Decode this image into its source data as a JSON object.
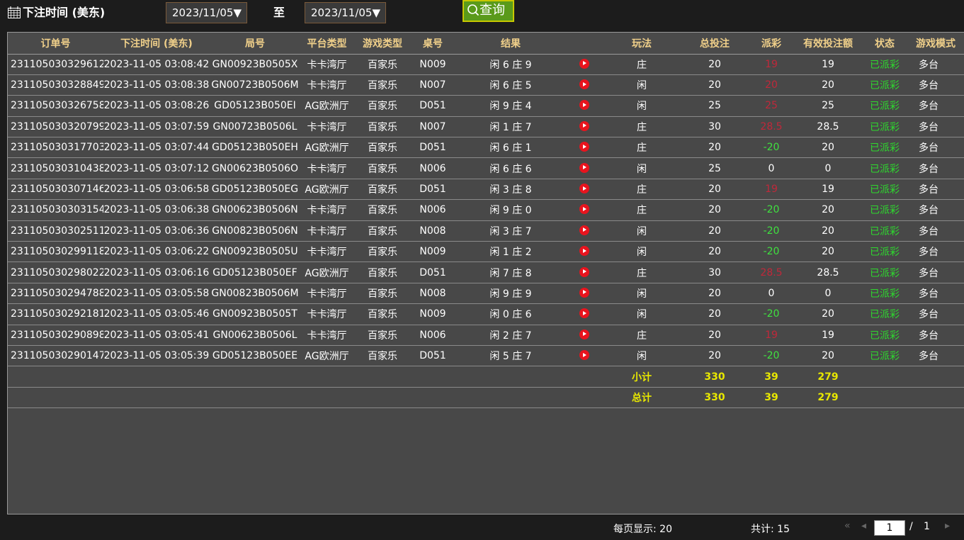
{
  "header": {
    "title": "下注时间 (美东)",
    "date_from": "2023/11/05",
    "to_label": "至",
    "date_to": "2023/11/05",
    "query_label": "查询"
  },
  "table": {
    "columns": [
      "订单号",
      "下注时间 (美东)",
      "局号",
      "平台类型",
      "游戏类型",
      "桌号",
      "结果",
      "",
      "玩法",
      "总投注",
      "派彩",
      "有效投注额",
      "状态",
      "游戏模式"
    ],
    "rows": [
      {
        "order": "231105030329612",
        "time": "2023-11-05 03:08:42",
        "round": "GN00923B0505X",
        "platform": "卡卡湾厅",
        "game": "百家乐",
        "table": "N009",
        "result": "闲 6 庄 9",
        "bet_type": "庄",
        "total": "20",
        "payout": "19",
        "payout_color": "red",
        "valid": "19",
        "status": "已派彩",
        "mode": "多台"
      },
      {
        "order": "231105030328849",
        "time": "2023-11-05 03:08:38",
        "round": "GN00723B0506M",
        "platform": "卡卡湾厅",
        "game": "百家乐",
        "table": "N007",
        "result": "闲 6 庄 5",
        "bet_type": "闲",
        "total": "20",
        "payout": "20",
        "payout_color": "red",
        "valid": "20",
        "status": "已派彩",
        "mode": "多台"
      },
      {
        "order": "231105030326758",
        "time": "2023-11-05 03:08:26",
        "round": "GD05123B050EI",
        "platform": "AG欧洲厅",
        "game": "百家乐",
        "table": "D051",
        "result": "闲 9 庄 4",
        "bet_type": "闲",
        "total": "25",
        "payout": "25",
        "payout_color": "red",
        "valid": "25",
        "status": "已派彩",
        "mode": "多台"
      },
      {
        "order": "231105030320799",
        "time": "2023-11-05 03:07:59",
        "round": "GN00723B0506L",
        "platform": "卡卡湾厅",
        "game": "百家乐",
        "table": "N007",
        "result": "闲 1 庄 7",
        "bet_type": "庄",
        "total": "30",
        "payout": "28.5",
        "payout_color": "red",
        "valid": "28.5",
        "status": "已派彩",
        "mode": "多台"
      },
      {
        "order": "231105030317703",
        "time": "2023-11-05 03:07:44",
        "round": "GD05123B050EH",
        "platform": "AG欧洲厅",
        "game": "百家乐",
        "table": "D051",
        "result": "闲 6 庄 1",
        "bet_type": "庄",
        "total": "20",
        "payout": "-20",
        "payout_color": "green",
        "valid": "20",
        "status": "已派彩",
        "mode": "多台"
      },
      {
        "order": "231105030310438",
        "time": "2023-11-05 03:07:12",
        "round": "GN00623B0506O",
        "platform": "卡卡湾厅",
        "game": "百家乐",
        "table": "N006",
        "result": "闲 6 庄 6",
        "bet_type": "闲",
        "total": "25",
        "payout": "0",
        "payout_color": "white",
        "valid": "0",
        "status": "已派彩",
        "mode": "多台"
      },
      {
        "order": "231105030307146",
        "time": "2023-11-05 03:06:58",
        "round": "GD05123B050EG",
        "platform": "AG欧洲厅",
        "game": "百家乐",
        "table": "D051",
        "result": "闲 3 庄 8",
        "bet_type": "庄",
        "total": "20",
        "payout": "19",
        "payout_color": "red",
        "valid": "19",
        "status": "已派彩",
        "mode": "多台"
      },
      {
        "order": "231105030303154",
        "time": "2023-11-05 03:06:38",
        "round": "GN00623B0506N",
        "platform": "卡卡湾厅",
        "game": "百家乐",
        "table": "N006",
        "result": "闲 9 庄 0",
        "bet_type": "庄",
        "total": "20",
        "payout": "-20",
        "payout_color": "green",
        "valid": "20",
        "status": "已派彩",
        "mode": "多台"
      },
      {
        "order": "231105030302511",
        "time": "2023-11-05 03:06:36",
        "round": "GN00823B0506N",
        "platform": "卡卡湾厅",
        "game": "百家乐",
        "table": "N008",
        "result": "闲 3 庄 7",
        "bet_type": "闲",
        "total": "20",
        "payout": "-20",
        "payout_color": "green",
        "valid": "20",
        "status": "已派彩",
        "mode": "多台"
      },
      {
        "order": "231105030299118",
        "time": "2023-11-05 03:06:22",
        "round": "GN00923B0505U",
        "platform": "卡卡湾厅",
        "game": "百家乐",
        "table": "N009",
        "result": "闲 1 庄 2",
        "bet_type": "闲",
        "total": "20",
        "payout": "-20",
        "payout_color": "green",
        "valid": "20",
        "status": "已派彩",
        "mode": "多台"
      },
      {
        "order": "231105030298022",
        "time": "2023-11-05 03:06:16",
        "round": "GD05123B050EF",
        "platform": "AG欧洲厅",
        "game": "百家乐",
        "table": "D051",
        "result": "闲 7 庄 8",
        "bet_type": "庄",
        "total": "30",
        "payout": "28.5",
        "payout_color": "red",
        "valid": "28.5",
        "status": "已派彩",
        "mode": "多台"
      },
      {
        "order": "231105030294788",
        "time": "2023-11-05 03:05:58",
        "round": "GN00823B0506M",
        "platform": "卡卡湾厅",
        "game": "百家乐",
        "table": "N008",
        "result": "闲 9 庄 9",
        "bet_type": "闲",
        "total": "20",
        "payout": "0",
        "payout_color": "white",
        "valid": "0",
        "status": "已派彩",
        "mode": "多台"
      },
      {
        "order": "231105030292181",
        "time": "2023-11-05 03:05:46",
        "round": "GN00923B0505T",
        "platform": "卡卡湾厅",
        "game": "百家乐",
        "table": "N009",
        "result": "闲 0 庄 6",
        "bet_type": "闲",
        "total": "20",
        "payout": "-20",
        "payout_color": "green",
        "valid": "20",
        "status": "已派彩",
        "mode": "多台"
      },
      {
        "order": "231105030290898",
        "time": "2023-11-05 03:05:41",
        "round": "GN00623B0506L",
        "platform": "卡卡湾厅",
        "game": "百家乐",
        "table": "N006",
        "result": "闲 2 庄 7",
        "bet_type": "庄",
        "total": "20",
        "payout": "19",
        "payout_color": "red",
        "valid": "19",
        "status": "已派彩",
        "mode": "多台"
      },
      {
        "order": "231105030290147",
        "time": "2023-11-05 03:05:39",
        "round": "GD05123B050EE",
        "platform": "AG欧洲厅",
        "game": "百家乐",
        "table": "D051",
        "result": "闲 5 庄 7",
        "bet_type": "闲",
        "total": "20",
        "payout": "-20",
        "payout_color": "green",
        "valid": "20",
        "status": "已派彩",
        "mode": "多台"
      }
    ],
    "subtotal": {
      "label": "小计",
      "total": "330",
      "payout": "39",
      "valid": "279"
    },
    "grand_total": {
      "label": "总计",
      "total": "330",
      "payout": "39",
      "valid": "279"
    }
  },
  "footer": {
    "per_page": "每页显示: 20",
    "total_count": "共计: 15",
    "current_page": "1",
    "separator": "/",
    "total_pages": "1"
  },
  "colors": {
    "red": "#c0283a",
    "green": "#3fe13f",
    "white": "#ffffff",
    "header_text": "#f0d08a",
    "sum_text": "#e8e800"
  }
}
